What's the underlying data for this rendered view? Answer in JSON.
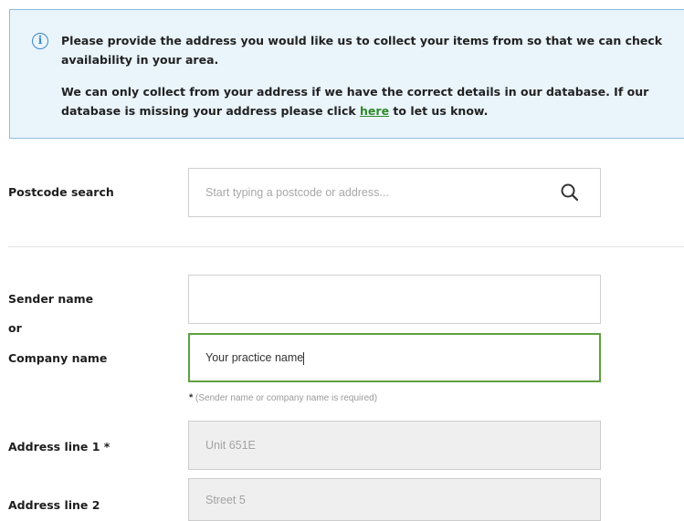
{
  "info": {
    "paragraph1": "Please provide the address you would like us to collect your items from so that we can check availability in your area.",
    "paragraph2_before": "We can only collect from your address if we have the correct details in our database. If our database is missing your address please click ",
    "paragraph2_link": "here",
    "paragraph2_after": " to let us know.",
    "icon": "info-circle-icon",
    "accent_color": "#3d88c8",
    "link_color": "#2f8a2a"
  },
  "postcode": {
    "label": "Postcode search",
    "placeholder": "Start typing a postcode or address...",
    "value": "",
    "icon": "search-icon"
  },
  "sender": {
    "label": "Sender name",
    "value": ""
  },
  "or_label": "or",
  "company": {
    "label": "Company name",
    "value": "Your practice name",
    "focus_color": "#5ea040"
  },
  "hint": {
    "star": "*",
    "text": " (Sender name or company name is required)"
  },
  "address1": {
    "label": "Address line 1 *",
    "value": "Unit 651E"
  },
  "address2": {
    "label": "Address line 2",
    "value": "Street 5"
  }
}
